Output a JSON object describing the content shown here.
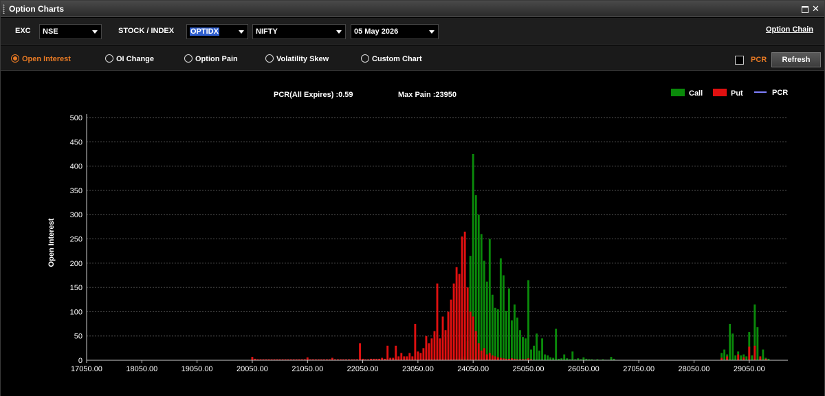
{
  "window": {
    "title": "Option Charts"
  },
  "toolbar": {
    "exc_label": "EXC",
    "exc_value": "NSE",
    "stock_label": "STOCK / INDEX",
    "instrument_value": "OPTIDX",
    "symbol_value": "NIFTY",
    "expiry_value": "05 May 2026",
    "option_chain_link": "Option Chain"
  },
  "modes": {
    "items": [
      {
        "label": "Open Interest",
        "active": true
      },
      {
        "label": "OI Change",
        "active": false
      },
      {
        "label": "Option Pain",
        "active": false
      },
      {
        "label": "Volatility Skew",
        "active": false
      },
      {
        "label": "Custom Chart",
        "active": false
      }
    ],
    "pcr_checkbox_label": "PCR",
    "refresh_label": "Refresh"
  },
  "stats": {
    "pcr_text": "PCR(All Expires) :0.59",
    "max_pain_text": "Max Pain :23950"
  },
  "chart_data": {
    "type": "bar",
    "ylabel": "Open Interest",
    "xlabel": "",
    "xlim": [
      17050,
      29750
    ],
    "ylim": [
      0,
      500
    ],
    "x_ticks": [
      17050,
      18050,
      19050,
      20050,
      21050,
      22050,
      23050,
      24050,
      25050,
      26050,
      27050,
      28050,
      29050
    ],
    "x_tick_labels": [
      "17050.00",
      "18050.00",
      "19050.00",
      "20050.00",
      "21050.00",
      "22050.00",
      "23050.00",
      "24050.00",
      "25050.00",
      "26050.00",
      "27050.00",
      "28050.00",
      "29050.00"
    ],
    "y_ticks": [
      0,
      50,
      100,
      150,
      200,
      250,
      300,
      350,
      400,
      450,
      500
    ],
    "grid": true,
    "legend_position": "top-right",
    "colors": {
      "call": "#0a8a0a",
      "put": "#e01010",
      "pcr": "#8080ff"
    },
    "series": [
      {
        "name": "Call",
        "points": [
          [
            23700,
            2
          ],
          [
            23750,
            3
          ],
          [
            23800,
            4
          ],
          [
            23850,
            6
          ],
          [
            23900,
            8
          ],
          [
            23950,
            40
          ],
          [
            24000,
            215
          ],
          [
            24050,
            425
          ],
          [
            24100,
            340
          ],
          [
            24150,
            300
          ],
          [
            24200,
            260
          ],
          [
            24250,
            205
          ],
          [
            24300,
            162
          ],
          [
            24350,
            250
          ],
          [
            24400,
            135
          ],
          [
            24450,
            108
          ],
          [
            24500,
            105
          ],
          [
            24550,
            210
          ],
          [
            24600,
            175
          ],
          [
            24650,
            102
          ],
          [
            24700,
            148
          ],
          [
            24750,
            82
          ],
          [
            24800,
            115
          ],
          [
            24850,
            88
          ],
          [
            24900,
            62
          ],
          [
            24950,
            48
          ],
          [
            25000,
            45
          ],
          [
            25050,
            165
          ],
          [
            25100,
            22
          ],
          [
            25150,
            30
          ],
          [
            25200,
            55
          ],
          [
            25250,
            20
          ],
          [
            25300,
            45
          ],
          [
            25350,
            12
          ],
          [
            25400,
            10
          ],
          [
            25450,
            6
          ],
          [
            25500,
            5
          ],
          [
            25550,
            65
          ],
          [
            25600,
            3
          ],
          [
            25650,
            4
          ],
          [
            25700,
            12
          ],
          [
            25750,
            4
          ],
          [
            25800,
            2
          ],
          [
            25850,
            18
          ],
          [
            25900,
            2
          ],
          [
            25950,
            4
          ],
          [
            26000,
            2
          ],
          [
            26050,
            6
          ],
          [
            26100,
            3
          ],
          [
            26150,
            2
          ],
          [
            26200,
            2
          ],
          [
            26250,
            1
          ],
          [
            26300,
            2
          ],
          [
            26350,
            1
          ],
          [
            26400,
            2
          ],
          [
            26450,
            1
          ],
          [
            26500,
            1
          ],
          [
            26550,
            7
          ],
          [
            26600,
            3
          ],
          [
            28550,
            15
          ],
          [
            28600,
            22
          ],
          [
            28650,
            12
          ],
          [
            28700,
            75
          ],
          [
            28750,
            55
          ],
          [
            28800,
            10
          ],
          [
            28850,
            18
          ],
          [
            28900,
            10
          ],
          [
            28950,
            12
          ],
          [
            29000,
            8
          ],
          [
            29050,
            58
          ],
          [
            29100,
            10
          ],
          [
            29150,
            115
          ],
          [
            29200,
            68
          ],
          [
            29250,
            5
          ],
          [
            29300,
            22
          ],
          [
            29350,
            5
          ],
          [
            29400,
            3
          ]
        ]
      },
      {
        "name": "Put",
        "points": [
          [
            20050,
            7
          ],
          [
            20100,
            3
          ],
          [
            20150,
            2
          ],
          [
            20200,
            2
          ],
          [
            20250,
            2
          ],
          [
            20300,
            2
          ],
          [
            20350,
            2
          ],
          [
            20400,
            2
          ],
          [
            20450,
            2
          ],
          [
            20500,
            2
          ],
          [
            20550,
            2
          ],
          [
            20600,
            2
          ],
          [
            20650,
            2
          ],
          [
            20700,
            2
          ],
          [
            20750,
            2
          ],
          [
            20800,
            2
          ],
          [
            20850,
            2
          ],
          [
            20900,
            2
          ],
          [
            20950,
            2
          ],
          [
            21000,
            2
          ],
          [
            21050,
            6
          ],
          [
            21100,
            2
          ],
          [
            21150,
            2
          ],
          [
            21200,
            2
          ],
          [
            21250,
            2
          ],
          [
            21300,
            2
          ],
          [
            21350,
            2
          ],
          [
            21400,
            2
          ],
          [
            21450,
            2
          ],
          [
            21500,
            5
          ],
          [
            21550,
            2
          ],
          [
            21600,
            2
          ],
          [
            21650,
            2
          ],
          [
            21700,
            2
          ],
          [
            21750,
            2
          ],
          [
            21800,
            2
          ],
          [
            21850,
            2
          ],
          [
            21900,
            2
          ],
          [
            21950,
            2
          ],
          [
            22000,
            35
          ],
          [
            22050,
            3
          ],
          [
            22100,
            2
          ],
          [
            22150,
            2
          ],
          [
            22200,
            3
          ],
          [
            22250,
            3
          ],
          [
            22300,
            3
          ],
          [
            22350,
            3
          ],
          [
            22400,
            5
          ],
          [
            22450,
            3
          ],
          [
            22500,
            30
          ],
          [
            22550,
            5
          ],
          [
            22600,
            5
          ],
          [
            22650,
            30
          ],
          [
            22700,
            8
          ],
          [
            22750,
            15
          ],
          [
            22800,
            8
          ],
          [
            22850,
            8
          ],
          [
            22900,
            15
          ],
          [
            22950,
            8
          ],
          [
            23000,
            75
          ],
          [
            23050,
            18
          ],
          [
            23100,
            15
          ],
          [
            23150,
            25
          ],
          [
            23200,
            50
          ],
          [
            23250,
            35
          ],
          [
            23300,
            45
          ],
          [
            23350,
            60
          ],
          [
            23400,
            158
          ],
          [
            23450,
            45
          ],
          [
            23500,
            90
          ],
          [
            23550,
            62
          ],
          [
            23600,
            100
          ],
          [
            23650,
            125
          ],
          [
            23700,
            158
          ],
          [
            23750,
            192
          ],
          [
            23800,
            178
          ],
          [
            23850,
            255
          ],
          [
            23900,
            265
          ],
          [
            23950,
            150
          ],
          [
            24000,
            100
          ],
          [
            24050,
            90
          ],
          [
            24100,
            60
          ],
          [
            24150,
            35
          ],
          [
            24200,
            20
          ],
          [
            24250,
            25
          ],
          [
            24300,
            12
          ],
          [
            24350,
            15
          ],
          [
            24400,
            10
          ],
          [
            24450,
            8
          ],
          [
            24500,
            6
          ],
          [
            24550,
            5
          ],
          [
            24600,
            4
          ],
          [
            24650,
            3
          ],
          [
            24700,
            3
          ],
          [
            24750,
            4
          ],
          [
            24800,
            3
          ],
          [
            24850,
            2
          ],
          [
            24900,
            2
          ],
          [
            24950,
            2
          ],
          [
            25000,
            2
          ],
          [
            25050,
            4
          ],
          [
            25100,
            2
          ],
          [
            28550,
            5
          ],
          [
            28650,
            8
          ],
          [
            28850,
            12
          ],
          [
            28950,
            6
          ],
          [
            29050,
            28
          ],
          [
            29150,
            30
          ],
          [
            29250,
            8
          ],
          [
            29350,
            3
          ]
        ]
      },
      {
        "name": "PCR",
        "points": []
      }
    ]
  }
}
